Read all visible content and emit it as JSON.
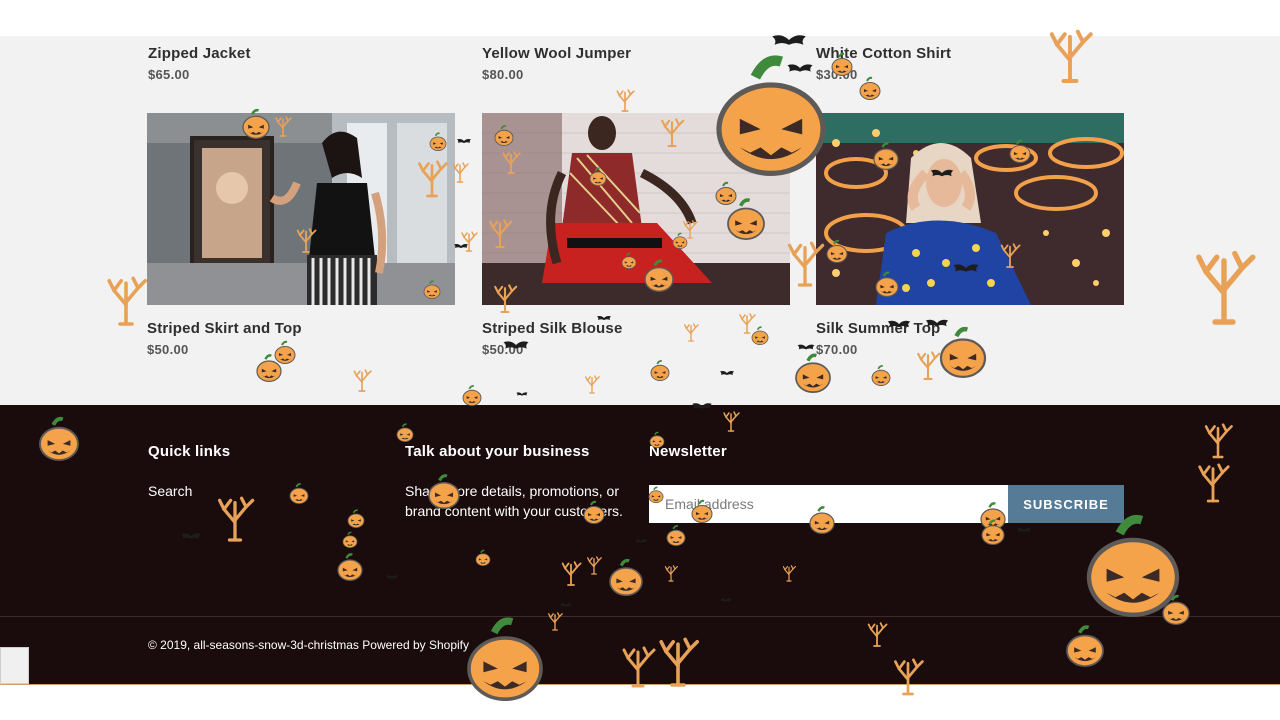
{
  "products_top": [
    {
      "title": "Zipped Jacket",
      "price": "$65.00"
    },
    {
      "title": "Yellow Wool Jumper",
      "price": "$80.00"
    },
    {
      "title": "White Cotton Shirt",
      "price": "$30.00"
    }
  ],
  "products_bottom": [
    {
      "title": "Striped Skirt and Top",
      "price": "$50.00",
      "image": "woman-black-top-striped-skirt-photo"
    },
    {
      "title": "Striped Silk Blouse",
      "price": "$50.00",
      "image": "woman-red-striped-silk-blouse-photo"
    },
    {
      "title": "Silk Summer Top",
      "price": "$70.00",
      "image": "woman-blue-summer-top-carnival-photo"
    }
  ],
  "footer": {
    "quick_links": {
      "heading": "Quick links",
      "items": [
        "Search"
      ]
    },
    "business": {
      "heading": "Talk about your business",
      "text": "Share store details, promotions, or brand content with your customers."
    },
    "newsletter": {
      "heading": "Newsletter",
      "email_placeholder": "Email address",
      "subscribe_label": "SUBSCRIBE"
    },
    "copyright": "© 2019, all-seasons-snow-3d-christmas Powered by Shopify"
  },
  "decorations": {
    "pumpkin_icon": "jack-o-lantern-icon",
    "tree_icon": "bare-tree-icon",
    "bat_icon": "bat-icon",
    "colors": {
      "pumpkin": "#f5a34a",
      "pumpkin_face": "#3b2a26",
      "tree": "#e8a258",
      "bat": "#1d1d1d",
      "footer_bg": "#1a0c0d",
      "section_bg": "#f2f2f2",
      "subscribe_bg": "#557b97"
    }
  }
}
